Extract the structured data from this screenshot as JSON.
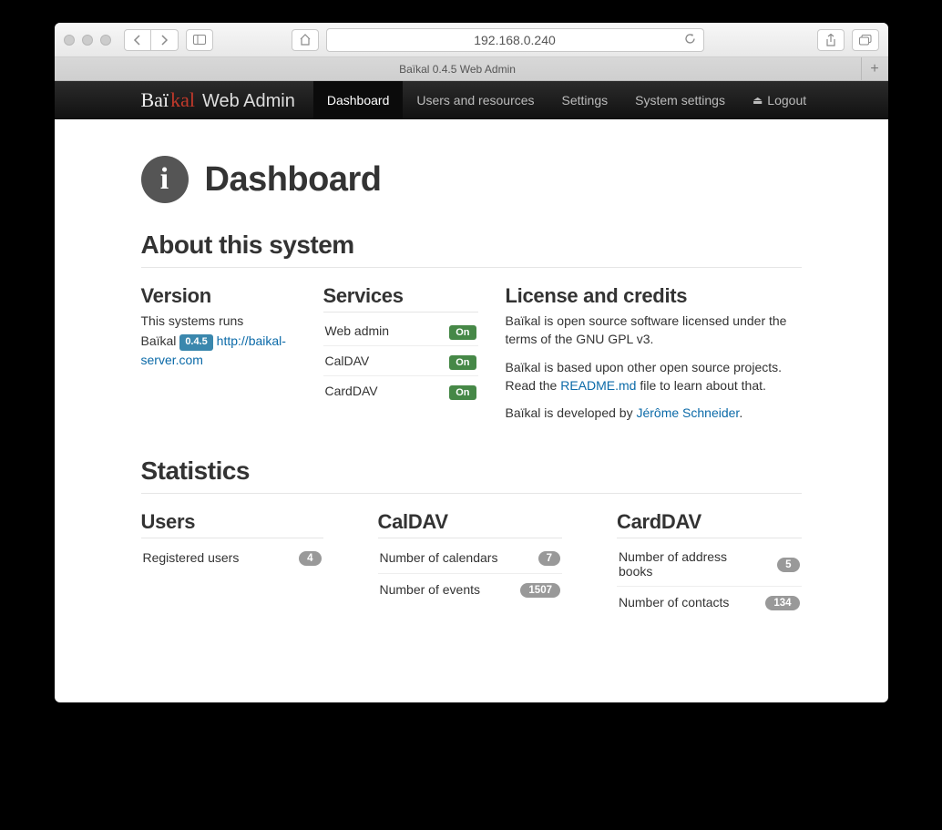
{
  "browser": {
    "address": "192.168.0.240",
    "tab_title": "Baïkal 0.4.5 Web Admin"
  },
  "navbar": {
    "brand_bai": "Baï",
    "brand_kal": "kal",
    "brand_suffix": "Web Admin",
    "items": {
      "dashboard": "Dashboard",
      "users": "Users and resources",
      "settings": "Settings",
      "system_settings": "System settings",
      "logout": "Logout"
    }
  },
  "page": {
    "title": "Dashboard",
    "about_heading": "About this system",
    "stats_heading": "Statistics"
  },
  "version": {
    "heading": "Version",
    "line1": "This systems runs",
    "product": "Baïkal",
    "badge": "0.4.5",
    "link_text": "http://baikal-server.com"
  },
  "services": {
    "heading": "Services",
    "rows": [
      {
        "name": "Web admin",
        "status": "On"
      },
      {
        "name": "CalDAV",
        "status": "On"
      },
      {
        "name": "CardDAV",
        "status": "On"
      }
    ]
  },
  "license": {
    "heading": "License and credits",
    "p1": "Baïkal is open source software licensed under the terms of the GNU GPL v3.",
    "p2a": "Baïkal is based upon other open source projects.",
    "p2b_pre": "Read the ",
    "p2b_link": "README.md",
    "p2b_post": " file to learn about that.",
    "p3_pre": "Baïkal is developed by ",
    "p3_link": "Jérôme Schneider",
    "p3_post": "."
  },
  "stats": {
    "users": {
      "heading": "Users",
      "rows": [
        {
          "label": "Registered users",
          "count": "4"
        }
      ]
    },
    "caldav": {
      "heading": "CalDAV",
      "rows": [
        {
          "label": "Number of calendars",
          "count": "7"
        },
        {
          "label": "Number of events",
          "count": "1507"
        }
      ]
    },
    "carddav": {
      "heading": "CardDAV",
      "rows": [
        {
          "label": "Number of address books",
          "count": "5"
        },
        {
          "label": "Number of contacts",
          "count": "134"
        }
      ]
    }
  }
}
